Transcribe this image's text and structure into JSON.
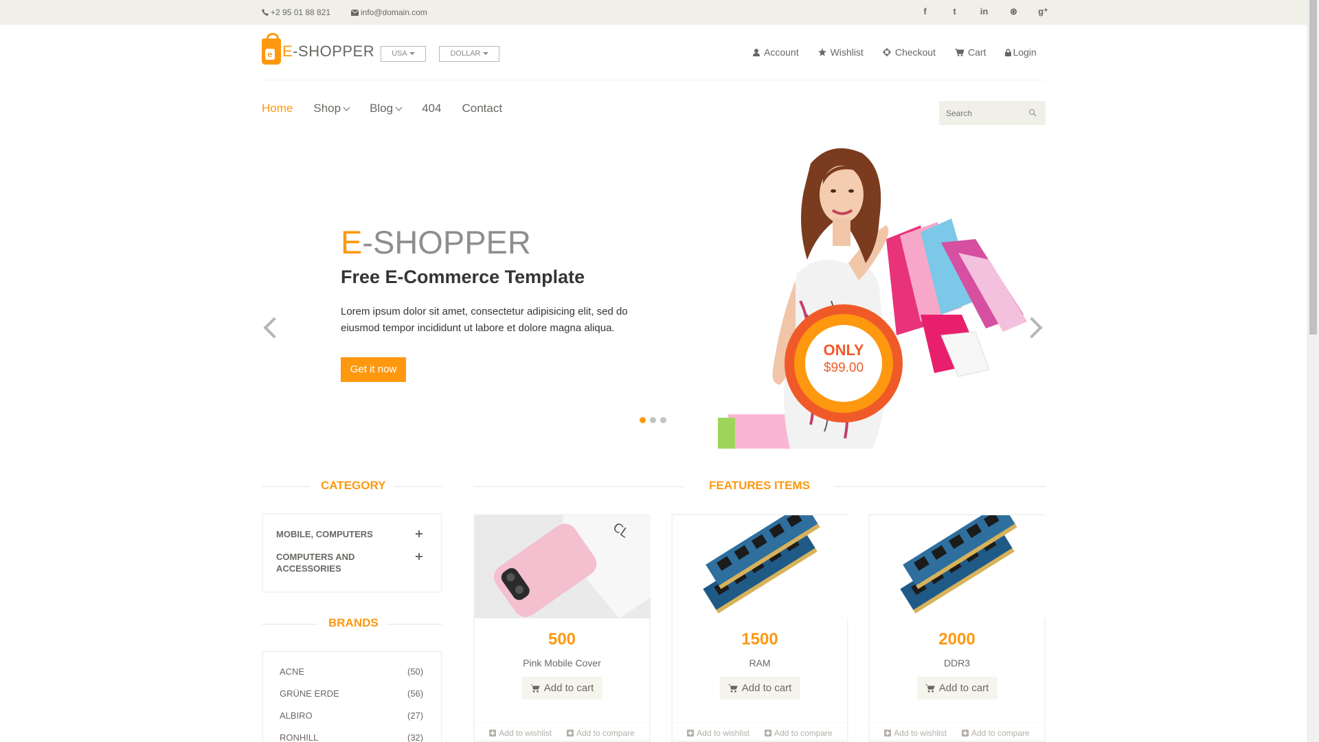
{
  "topbar": {
    "phone": "+2 95 01 88 821",
    "email": "info@domain.com",
    "social": [
      "facebook-icon",
      "twitter-icon",
      "linkedin-icon",
      "dribbble-icon",
      "google-plus-icon"
    ],
    "social_glyphs": [
      "f",
      "t",
      "in",
      "⊛",
      "g⁺"
    ]
  },
  "header": {
    "logo_e": "E",
    "logo_rest": "-SHOPPER",
    "logo_badge": "e",
    "country": "USA",
    "currency": "DOLLAR",
    "menu": [
      "Account",
      "Wishlist",
      "Checkout",
      "Cart",
      "Login"
    ]
  },
  "nav": {
    "items": [
      "Home",
      "Shop",
      "Blog",
      "404",
      "Contact"
    ],
    "search_placeholder": "Search"
  },
  "slider": {
    "brand_e": "E",
    "brand_rest": "-SHOPPER",
    "title": "Free E-Commerce Template",
    "text": "Lorem ipsum dolor sit amet, consectetur adipisicing elit, sed do eiusmod tempor incididunt ut labore et dolore magna aliqua.",
    "button": "Get it now",
    "badge_only": "ONLY",
    "badge_price": "$99.00",
    "active_slide": 1,
    "slide_count": 3
  },
  "sidebar": {
    "category_title": "CATEGORY",
    "categories": [
      "MOBILE, COMPUTERS",
      "COMPUTERS AND ACCESSORIES"
    ],
    "brands_title": "BRANDS",
    "brands": [
      {
        "name": "ACNE",
        "count": "(50)"
      },
      {
        "name": "GRÜNE ERDE",
        "count": "(56)"
      },
      {
        "name": "ALBIRO",
        "count": "(27)"
      },
      {
        "name": "RONHILL",
        "count": "(32)"
      }
    ]
  },
  "features": {
    "title": "FEATURES ITEMS",
    "products": [
      {
        "price": "500",
        "name": "Pink Mobile Cover",
        "cart": "Add to cart",
        "wishlist": "Add to wishlist",
        "compare": "Add to compare"
      },
      {
        "price": "1500",
        "name": "RAM",
        "cart": "Add to cart",
        "wishlist": "Add to wishlist",
        "compare": "Add to compare"
      },
      {
        "price": "2000",
        "name": "DDR3",
        "cart": "Add to cart",
        "wishlist": "Add to wishlist",
        "compare": "Add to compare"
      }
    ]
  },
  "colors": {
    "accent": "#FE980F",
    "topbar_bg": "#F0F0E9",
    "text": "#696763",
    "heading": "#363432",
    "badge_red": "#F05A28"
  }
}
